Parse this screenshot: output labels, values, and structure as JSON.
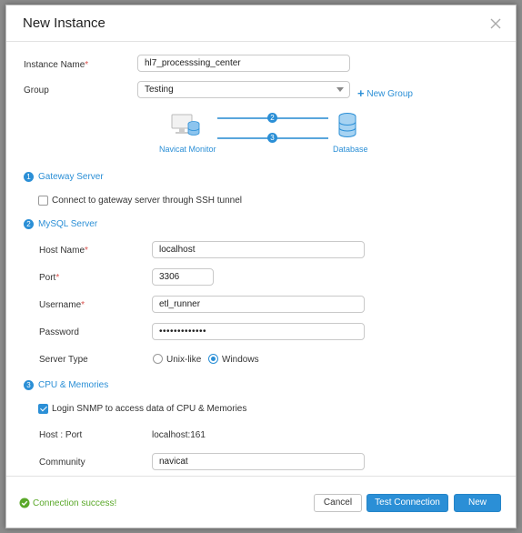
{
  "dialog": {
    "title": "New Instance",
    "close_icon": "close-icon"
  },
  "instance": {
    "name_label": "Instance Name",
    "name_value": "hl7_processsing_center",
    "group_label": "Group",
    "group_value": "Testing",
    "new_group_label": "New Group"
  },
  "diagram": {
    "left_label": "Navicat Monitor",
    "right_label": "Database",
    "step_top": "2",
    "step_bottom": "3",
    "left_icon": "monitor-server-icon",
    "right_icon": "database-icon"
  },
  "gateway": {
    "number": "1",
    "title": "Gateway Server",
    "ssh_label": "Connect to gateway server through SSH tunnel",
    "ssh_checked": false
  },
  "mysql": {
    "number": "2",
    "title": "MySQL Server",
    "host_label": "Host Name",
    "host_value": "localhost",
    "port_label": "Port",
    "port_value": "3306",
    "username_label": "Username",
    "username_value": "etl_runner",
    "password_label": "Password",
    "password_value": "•••••••••••••",
    "server_type_label": "Server Type",
    "server_type_options": [
      "Unix-like",
      "Windows"
    ],
    "server_type_selected": "Windows"
  },
  "cpu": {
    "number": "3",
    "title": "CPU & Memories",
    "snmp_label": "Login SNMP to access data of CPU & Memories",
    "snmp_checked": true,
    "host_port_label": "Host : Port",
    "host_port_value": "localhost:161",
    "community_label": "Community",
    "community_value": "navicat"
  },
  "footer": {
    "status_text": "Connection success!",
    "status_color": "#5aa829",
    "cancel_label": "Cancel",
    "test_label": "Test Connection",
    "new_label": "New"
  },
  "colors": {
    "accent": "#2b8fd6",
    "required": "#d9534f"
  }
}
